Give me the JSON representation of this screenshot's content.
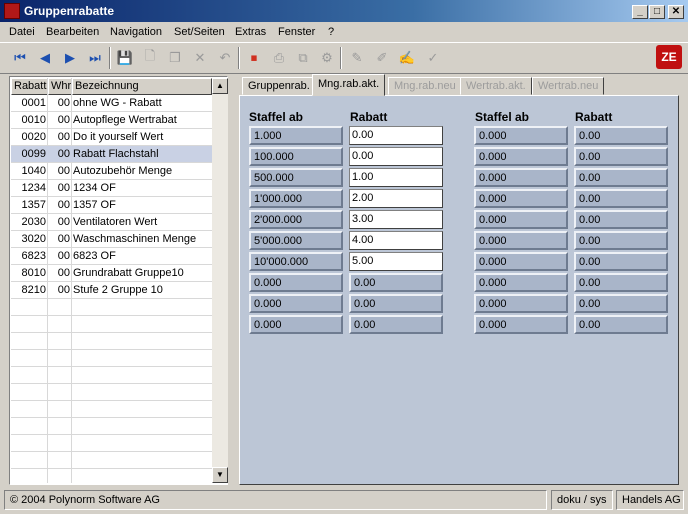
{
  "window": {
    "title": "Gruppenrabatte",
    "controls": {
      "minimize": "_",
      "maximize": "□",
      "close": "✕"
    }
  },
  "menu": {
    "items": [
      {
        "label": "Datei"
      },
      {
        "label": "Bearbeiten"
      },
      {
        "label": "Navigation"
      },
      {
        "label": "Set/Seiten"
      },
      {
        "label": "Extras"
      },
      {
        "label": "Fenster"
      },
      {
        "label": "?"
      }
    ]
  },
  "toolbar": {
    "buttons": [
      {
        "icon": "first-record-icon",
        "glyph": "⏮"
      },
      {
        "icon": "previous-record-icon",
        "glyph": "◀"
      },
      {
        "icon": "next-record-icon",
        "glyph": "▶"
      },
      {
        "icon": "last-record-icon",
        "glyph": "⏭"
      },
      {
        "icon": "save-icon",
        "glyph": "💾"
      },
      {
        "icon": "new-document-icon",
        "glyph": "🗋"
      },
      {
        "icon": "copy-icon",
        "glyph": "❐"
      },
      {
        "icon": "delete-icon",
        "glyph": "✕"
      },
      {
        "icon": "undo-icon",
        "glyph": "↶"
      },
      {
        "icon": "stop-icon",
        "glyph": "⏹"
      },
      {
        "icon": "print-icon",
        "glyph": "⎙"
      },
      {
        "icon": "tree-icon",
        "glyph": "⧉"
      },
      {
        "icon": "settings-icon",
        "glyph": "⚙"
      },
      {
        "icon": "edit-icon",
        "glyph": "✎"
      },
      {
        "icon": "pen-icon",
        "glyph": "✐"
      },
      {
        "icon": "document-edit-icon",
        "glyph": "✍"
      },
      {
        "icon": "check-icon",
        "glyph": "✓"
      }
    ],
    "logo_text": "ZE",
    "colors": {
      "active_blue": "#1c4fb0",
      "disabled": "#9a9a9a",
      "stop_red": "#d03020"
    }
  },
  "list": {
    "columns": [
      "Rabatt",
      "Whr",
      "Bezeichnung"
    ],
    "rows": [
      {
        "rabatt": "0001",
        "whr": "00",
        "bez": "ohne WG - Rabatt"
      },
      {
        "rabatt": "0010",
        "whr": "00",
        "bez": "Autopflege Wertrabat"
      },
      {
        "rabatt": "0020",
        "whr": "00",
        "bez": "Do it yourself Wert"
      },
      {
        "rabatt": "0099",
        "whr": "00",
        "bez": "Rabatt Flachstahl",
        "selected": true
      },
      {
        "rabatt": "1040",
        "whr": "00",
        "bez": "Autozubehör Menge"
      },
      {
        "rabatt": "1234",
        "whr": "00",
        "bez": "1234 OF"
      },
      {
        "rabatt": "1357",
        "whr": "00",
        "bez": "1357 OF"
      },
      {
        "rabatt": "2030",
        "whr": "00",
        "bez": "Ventilatoren Wert"
      },
      {
        "rabatt": "3020",
        "whr": "00",
        "bez": "Waschmaschinen Menge"
      },
      {
        "rabatt": "6823",
        "whr": "00",
        "bez": "6823 OF"
      },
      {
        "rabatt": "8010",
        "whr": "00",
        "bez": "Grundrabatt Gruppe10"
      },
      {
        "rabatt": "8210",
        "whr": "00",
        "bez": "Stufe 2 Gruppe 10"
      }
    ],
    "selected_color": "#c9d1e4"
  },
  "tabs": [
    {
      "label": "Gruppenrab.",
      "state": "normal"
    },
    {
      "label": "Mng.rab.akt.",
      "state": "active"
    },
    {
      "label": "Mng.rab.neu",
      "state": "disabled"
    },
    {
      "label": "Wertrab.akt.",
      "state": "disabled"
    },
    {
      "label": "Wertrab.neu",
      "state": "disabled"
    }
  ],
  "panel": {
    "headers": [
      "Staffel ab",
      "Rabatt",
      "Staffel ab",
      "Rabatt"
    ],
    "left_rows": [
      {
        "staffel": "1.000",
        "rabatt": "0.00"
      },
      {
        "staffel": "100.000",
        "rabatt": "0.00"
      },
      {
        "staffel": "500.000",
        "rabatt": "1.00"
      },
      {
        "staffel": "1'000.000",
        "rabatt": "2.00"
      },
      {
        "staffel": "2'000.000",
        "rabatt": "3.00"
      },
      {
        "staffel": "5'000.000",
        "rabatt": "4.00"
      },
      {
        "staffel": "10'000.000",
        "rabatt": "5.00"
      },
      {
        "staffel": "0.000",
        "rabatt": "0.00"
      },
      {
        "staffel": "0.000",
        "rabatt": "0.00"
      },
      {
        "staffel": "0.000",
        "rabatt": "0.00"
      }
    ],
    "left_editable_rabatt_rows": 7,
    "right_rows": [
      {
        "staffel": "0.000",
        "rabatt": "0.00"
      },
      {
        "staffel": "0.000",
        "rabatt": "0.00"
      },
      {
        "staffel": "0.000",
        "rabatt": "0.00"
      },
      {
        "staffel": "0.000",
        "rabatt": "0.00"
      },
      {
        "staffel": "0.000",
        "rabatt": "0.00"
      },
      {
        "staffel": "0.000",
        "rabatt": "0.00"
      },
      {
        "staffel": "0.000",
        "rabatt": "0.00"
      },
      {
        "staffel": "0.000",
        "rabatt": "0.00"
      },
      {
        "staffel": "0.000",
        "rabatt": "0.00"
      },
      {
        "staffel": "0.000",
        "rabatt": "0.00"
      }
    ],
    "background_color": "#bcc6d6"
  },
  "status": {
    "copyright": "© 2004 Polynorm Software AG",
    "user": "doku / sys",
    "company": "Handels AG"
  }
}
